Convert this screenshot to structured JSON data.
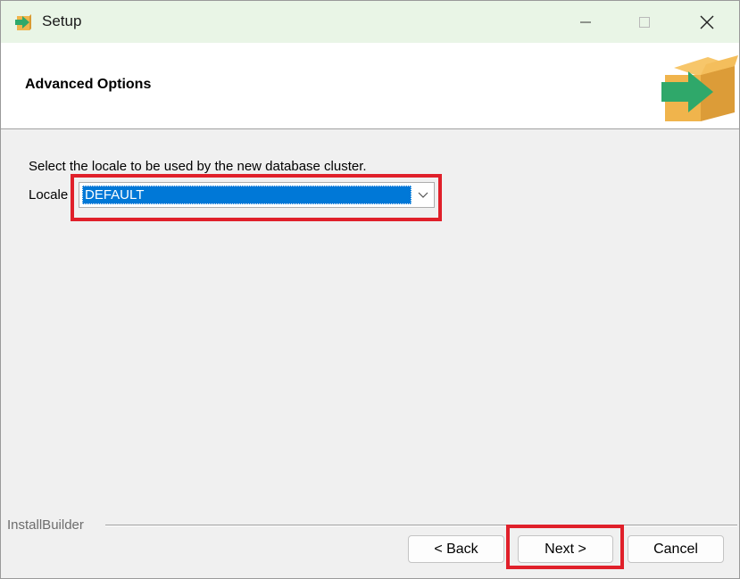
{
  "window": {
    "title": "Setup"
  },
  "header": {
    "title": "Advanced Options"
  },
  "body": {
    "instruction": "Select the locale to be used by the new database cluster.",
    "locale_label": "Locale",
    "locale_value": "DEFAULT"
  },
  "footer": {
    "brand": "InstallBuilder",
    "back_label": "< Back",
    "next_label": "Next >",
    "cancel_label": "Cancel"
  },
  "colors": {
    "titlebar_bg": "#e9f5e6",
    "selection_blue": "#0078d7",
    "highlight_red": "#e0202a",
    "logo_green": "#2fa86a",
    "logo_orange": "#f0b44c"
  },
  "icons": {
    "app": "installer-box-arrow-icon",
    "minimize": "minimize-icon",
    "maximize": "maximize-icon",
    "close": "close-icon",
    "dropdown": "chevron-down-icon"
  }
}
